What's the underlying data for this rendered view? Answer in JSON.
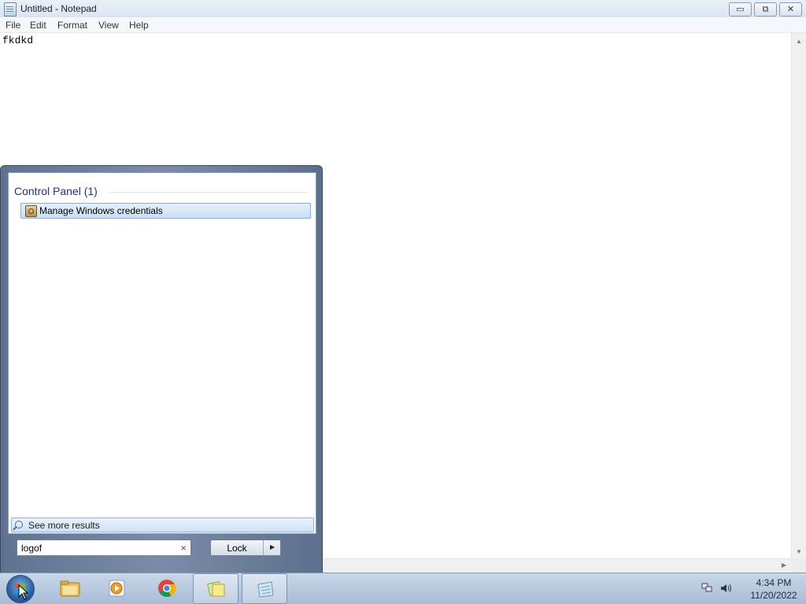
{
  "notepad": {
    "title": "Untitled - Notepad",
    "menu": [
      "File",
      "Edit",
      "Format",
      "View",
      "Help"
    ],
    "content": "fkdkd",
    "caption_buttons": {
      "minimize": "▭",
      "restore": "⧉",
      "close": "✕"
    }
  },
  "start_menu": {
    "group_header": "Control Panel (1)",
    "results": [
      {
        "label": "Manage Windows credentials",
        "icon": "credential-manager-icon"
      }
    ],
    "see_more": "See more results",
    "search": {
      "value": "logof",
      "clear_glyph": "×"
    },
    "power_button": {
      "label": "Lock",
      "arrow": "▶"
    }
  },
  "taskbar": {
    "apps": [
      {
        "name": "windows-explorer",
        "icon": "folder-icon",
        "active": false
      },
      {
        "name": "media-player",
        "icon": "media-player-icon",
        "active": false
      },
      {
        "name": "chrome",
        "icon": "chrome-icon",
        "active": false
      },
      {
        "name": "sticky-notes",
        "icon": "sticky-notes-icon",
        "active": true
      },
      {
        "name": "notepad",
        "icon": "notepad-icon",
        "active": true
      }
    ],
    "clock": {
      "time": "4:34 PM",
      "date": "11/20/2022"
    }
  },
  "colors": {
    "title_text": "#1e3287",
    "selection_blue": "#c9def5",
    "taskbar": "#b8c9de"
  }
}
